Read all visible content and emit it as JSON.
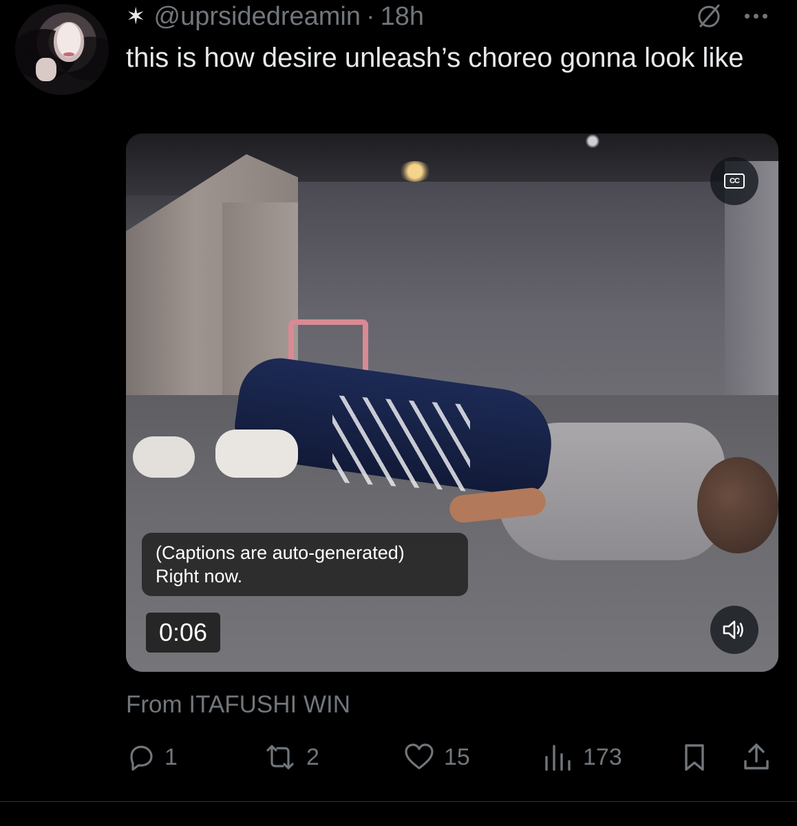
{
  "tweet": {
    "star_glyph": "✶",
    "handle": "@uprsidedreamin",
    "separator": "·",
    "time_ago": "18h",
    "text": "this is how desire unleash’s choreo gonna look like"
  },
  "video": {
    "captions_line1": "(Captions are auto-generated)",
    "captions_line2": "Right now.",
    "timestamp": "0:06",
    "cc_label": "CC",
    "source": "From ITAFUSHI WIN"
  },
  "actions": {
    "replies": "1",
    "reposts": "2",
    "likes": "15",
    "views": "173"
  },
  "icons": {
    "grok": "grok-slash-icon",
    "more": "more-dots-icon",
    "reply": "reply-bubble-icon",
    "repost": "repost-arrows-icon",
    "like": "heart-icon",
    "views": "bar-chart-icon",
    "bookmark": "bookmark-icon",
    "share": "share-upload-icon",
    "volume": "speaker-icon",
    "cc": "closed-captions-icon"
  },
  "colors": {
    "background": "#000000",
    "text_primary": "#e7e9ea",
    "text_secondary": "#71767b",
    "divider": "#2f3336"
  }
}
